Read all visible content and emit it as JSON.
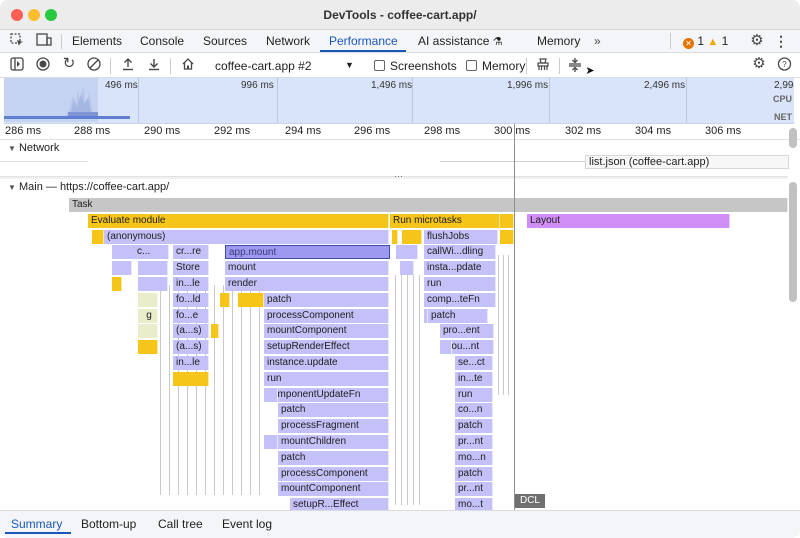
{
  "window": {
    "title": "DevTools - coffee-cart.app/"
  },
  "colors": {
    "accent": "#1a57b8",
    "task": "#c6c6c6",
    "script": "#f6c51a",
    "js": "#c4c0f8",
    "layout": "#d08ef6",
    "selected": "#9d98f0",
    "overview_bg": "#d9e4fb"
  },
  "main_tabs": [
    {
      "label": "Elements"
    },
    {
      "label": "Console"
    },
    {
      "label": "Sources"
    },
    {
      "label": "Network"
    },
    {
      "label": "Performance",
      "active": true
    },
    {
      "label": "AI assistance"
    },
    {
      "label": "Memory"
    }
  ],
  "badges": {
    "errors": "1",
    "warnings": "1"
  },
  "toolbar": {
    "recording": "coffee-cart.app #2",
    "screenshots_label": "Screenshots",
    "memory_label": "Memory",
    "screenshots_checked": false,
    "memory_checked": false
  },
  "overview": {
    "labels": [
      "496 ms",
      "996 ms",
      "1,496 ms",
      "1,996 ms",
      "2,496 ms",
      "2,99"
    ],
    "cpu_label": "CPU",
    "net_label": "NET"
  },
  "ruler": {
    "ticks": [
      "286 ms",
      "288 ms",
      "290 ms",
      "292 ms",
      "294 ms",
      "296 ms",
      "298 ms",
      "300 ms",
      "302 ms",
      "304 ms",
      "306 ms"
    ]
  },
  "network": {
    "track_label": "Network",
    "request": "list.json (coffee-cart.app)"
  },
  "main": {
    "track_label": "Main — https://coffee-cart.app/",
    "dcl": "DCL",
    "left_labels": [
      "c...",
      "cr...re",
      "Store",
      "in...le",
      "fo...ld",
      "g",
      "fo...e",
      "(a...s)",
      "(a...s)",
      "in...le"
    ],
    "center_stack": [
      "app.mount",
      "mount",
      "render",
      "patch",
      "processComponent",
      "mountComponent",
      "setupRenderEffect",
      "instance.update",
      "run",
      "componentUpdateFn",
      "patch",
      "processFragment",
      "mountChildren",
      "patch",
      "processComponent",
      "mountComponent",
      "setupR...Effect"
    ],
    "right_stack": [
      "flushJobs",
      "callWi...dling",
      "insta...pdate",
      "run",
      "comp...teFn",
      "patch",
      "pro...ent",
      "mou...nt",
      "se...ct",
      "in...te",
      "run",
      "co...n",
      "patch",
      "pr...nt",
      "mo...n",
      "patch",
      "pr...nt",
      "mo...t"
    ],
    "task": "Task",
    "evaluate_module": "Evaluate module",
    "run_microtasks": "Run microtasks",
    "layout": "Layout",
    "anonymous": "(anonymous)"
  },
  "bottom_tabs": [
    {
      "label": "Summary",
      "active": true
    },
    {
      "label": "Bottom-up"
    },
    {
      "label": "Call tree"
    },
    {
      "label": "Event log"
    }
  ]
}
